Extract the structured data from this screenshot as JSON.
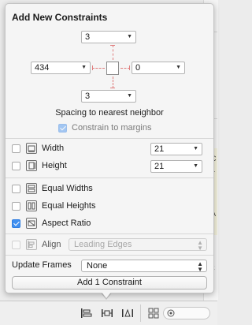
{
  "popover": {
    "title": "Add New Constraints",
    "spacing": {
      "top": "3",
      "left": "434",
      "right": "0",
      "bottom": "3",
      "label": "Spacing to nearest neighbor",
      "constrain_to_margins_label": "Constrain to margins",
      "constrain_to_margins_checked": true
    },
    "size_rows": [
      {
        "label": "Width",
        "checked": false,
        "value": "21"
      },
      {
        "label": "Height",
        "checked": false,
        "value": "21"
      }
    ],
    "equal_rows": [
      {
        "label": "Equal Widths",
        "checked": false
      },
      {
        "label": "Equal Heights",
        "checked": false
      },
      {
        "label": "Aspect Ratio",
        "checked": true
      }
    ],
    "align": {
      "label": "Align",
      "value": "Leading Edges",
      "enabled": false
    },
    "update_frames": {
      "label": "Update Frames",
      "value": "None"
    },
    "add_button_label": "Add 1 Constraint"
  },
  "background": {
    "editor_fragments": [
      "C",
      "L",
      "A",
      "k"
    ]
  },
  "bottom_bar": {
    "icons": [
      "align-icon",
      "pin-icon",
      "resolve-icon",
      "grid-icon",
      "target-icon"
    ]
  },
  "colors": {
    "accent": "#3f8ff0",
    "strut": "#e07d7d"
  }
}
